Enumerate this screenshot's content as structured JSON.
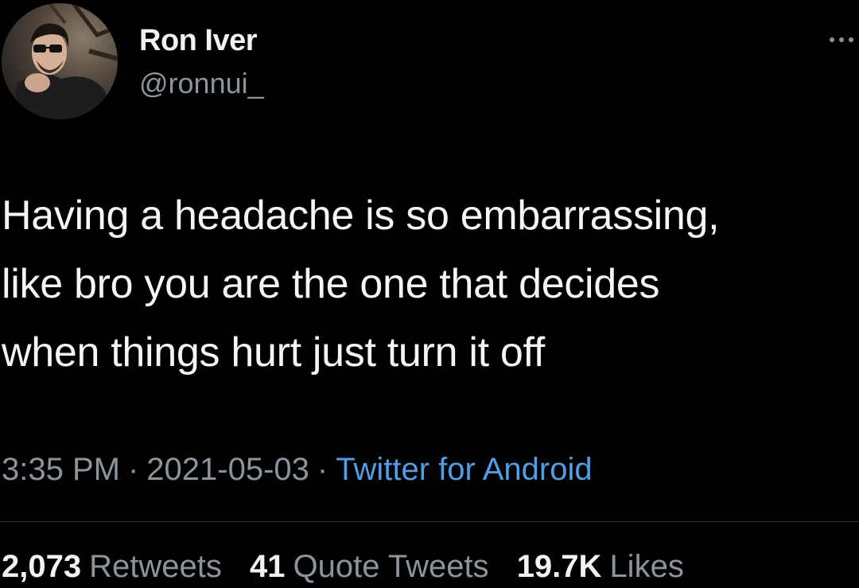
{
  "user": {
    "display_name": "Ron Iver",
    "handle": "@ronnui_",
    "avatar_icon": "profile-photo"
  },
  "menu_icon": "more-options-icon",
  "tweet": {
    "lines": [
      "Having a headache is so embarrassing,",
      "like bro you are the one that decides",
      "when things hurt just turn it off"
    ]
  },
  "meta": {
    "time": "3:35 PM",
    "date": "2021-05-03",
    "separator": "·",
    "source": "Twitter for Android"
  },
  "stats": {
    "retweets_count": "2,073",
    "retweets_label": "Retweets",
    "quotes_count": "41",
    "quotes_label": "Quote Tweets",
    "likes_count": "19.7K",
    "likes_label": "Likes"
  },
  "colors": {
    "background": "#000000",
    "text": "#e7e9ea",
    "muted": "#8b949c",
    "link": "#4f9ee6",
    "divider": "#2f3336"
  }
}
